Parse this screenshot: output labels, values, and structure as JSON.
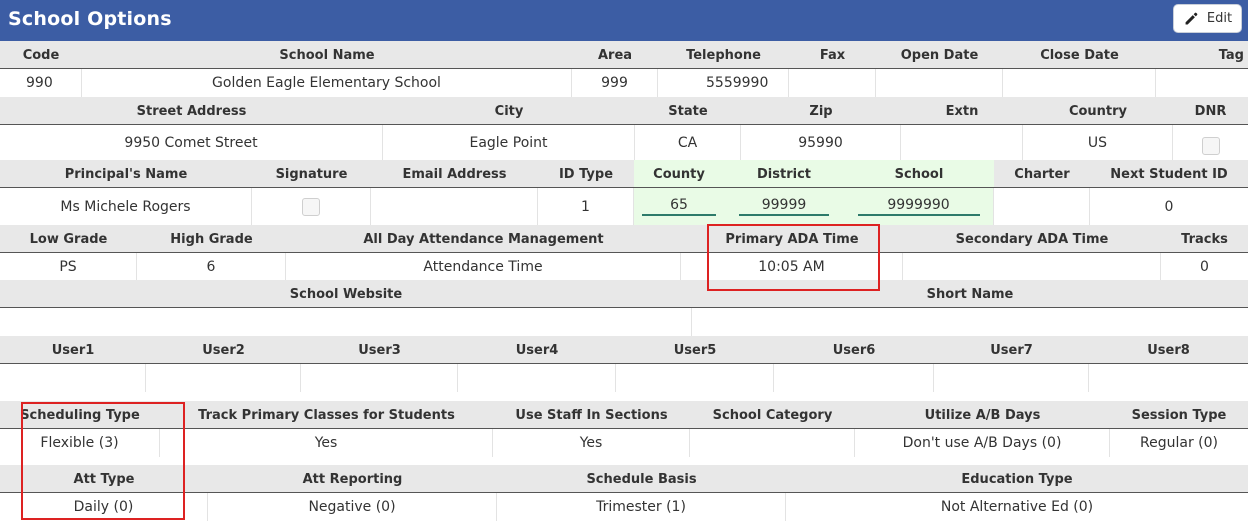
{
  "window": {
    "title": "School Options",
    "edit_label": "Edit"
  },
  "row1": {
    "headers": [
      "Code",
      "School Name",
      "Area",
      "Telephone",
      "Fax",
      "Open Date",
      "Close Date",
      "Tag"
    ],
    "values": [
      "990",
      "Golden Eagle Elementary School",
      "999",
      "5559990",
      "",
      "",
      "",
      ""
    ]
  },
  "row2": {
    "headers": [
      "Street Address",
      "City",
      "State",
      "Zip",
      "Extn",
      "Country",
      "DNR"
    ],
    "values": [
      "9950 Comet Street",
      "Eagle Point",
      "CA",
      "95990",
      "",
      "US",
      ""
    ]
  },
  "row3": {
    "headers": [
      "Principal's Name",
      "Signature",
      "Email Address",
      "ID Type",
      "County",
      "District",
      "School",
      "Charter",
      "Next Student ID"
    ],
    "values": [
      "Ms Michele Rogers",
      "",
      "",
      "1",
      "65",
      "99999",
      "9999990",
      "",
      "0"
    ]
  },
  "row4": {
    "headers": [
      "Low Grade",
      "High Grade",
      "All Day Attendance Management",
      "Primary ADA Time",
      "Secondary ADA Time",
      "Tracks"
    ],
    "values": [
      "PS",
      "6",
      "Attendance Time",
      "10:05 AM",
      "",
      "0"
    ]
  },
  "row5": {
    "headers": [
      "School Website",
      "Short Name"
    ],
    "values": [
      "",
      ""
    ]
  },
  "row6": {
    "headers": [
      "User1",
      "User2",
      "User3",
      "User4",
      "User5",
      "User6",
      "User7",
      "User8"
    ],
    "values": [
      "",
      "",
      "",
      "",
      "",
      "",
      "",
      ""
    ]
  },
  "row7": {
    "headers": [
      "Scheduling Type",
      "Track Primary Classes for Students",
      "Use Staff In Sections",
      "School Category",
      "Utilize A/B Days",
      "Session Type"
    ],
    "values": [
      "Flexible (3)",
      "Yes",
      "Yes",
      "",
      "Don't use A/B Days (0)",
      "Regular (0)"
    ]
  },
  "row8": {
    "headers": [
      "Att Type",
      "Att Reporting",
      "Schedule Basis",
      "Education Type"
    ],
    "values": [
      "Daily (0)",
      "Negative (0)",
      "Trimester (1)",
      "Not Alternative Ed (0)"
    ]
  },
  "colors": {
    "titlebar": "#3c5da4",
    "highlight": "#dd2222",
    "id_field_bg": "#e9fbe6"
  }
}
